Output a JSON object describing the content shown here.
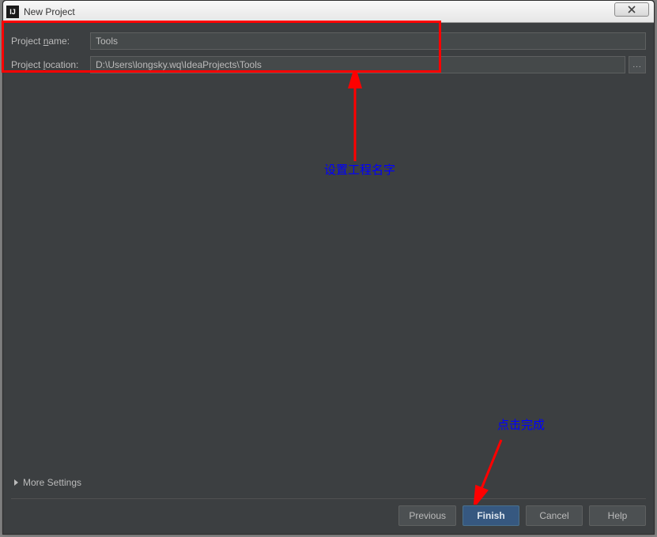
{
  "window": {
    "title": "New Project",
    "icon_glyph": "IJ"
  },
  "form": {
    "project_name_label": "Project name:",
    "project_name_value": "Tools",
    "project_location_label": "Project location:",
    "project_location_value": "D:\\Users\\longsky.wq\\IdeaProjects\\Tools",
    "browse_label": "..."
  },
  "more_settings_label": "More Settings",
  "buttons": {
    "previous": "Previous",
    "finish": "Finish",
    "cancel": "Cancel",
    "help": "Help"
  },
  "annotations": {
    "text1": "设置工程名字",
    "text2": "点击完成"
  }
}
